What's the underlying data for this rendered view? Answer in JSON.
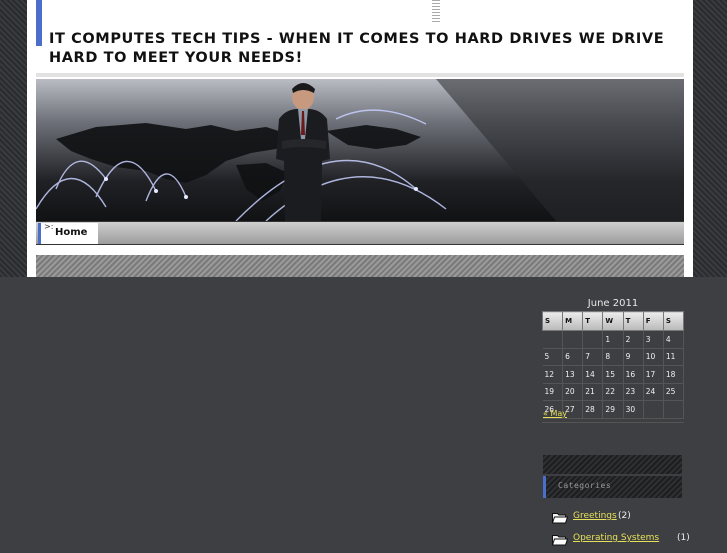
{
  "site": {
    "title": "IT COMPUTES TECH TIPS - WHEN IT COMES TO HARD DRIVES WE DRIVE HARD TO MEET YOUR NEEDS!"
  },
  "nav": {
    "items": [
      {
        "label": "Home",
        "active": true
      }
    ]
  },
  "calendar": {
    "caption": "June 2011",
    "weekdays": [
      "S",
      "M",
      "T",
      "W",
      "T",
      "F",
      "S"
    ],
    "weeks": [
      [
        "",
        "",
        "",
        "1",
        "2",
        "3",
        "4"
      ],
      [
        "5",
        "6",
        "7",
        "8",
        "9",
        "10",
        "11"
      ],
      [
        "12",
        "13",
        "14",
        "15",
        "16",
        "17",
        "18"
      ],
      [
        "19",
        "20",
        "21",
        "22",
        "23",
        "24",
        "25"
      ],
      [
        "26",
        "27",
        "28",
        "29",
        "30",
        "",
        ""
      ]
    ],
    "prev_link": "« May"
  },
  "categories": {
    "title": "Categories",
    "items": [
      {
        "label": "Greetings",
        "count": "(2)"
      },
      {
        "label": "Operating Systems",
        "count": "(1)"
      }
    ]
  },
  "colors": {
    "accent": "#4a6ec9",
    "link": "#e6e05a",
    "background": "#3e3f43"
  }
}
